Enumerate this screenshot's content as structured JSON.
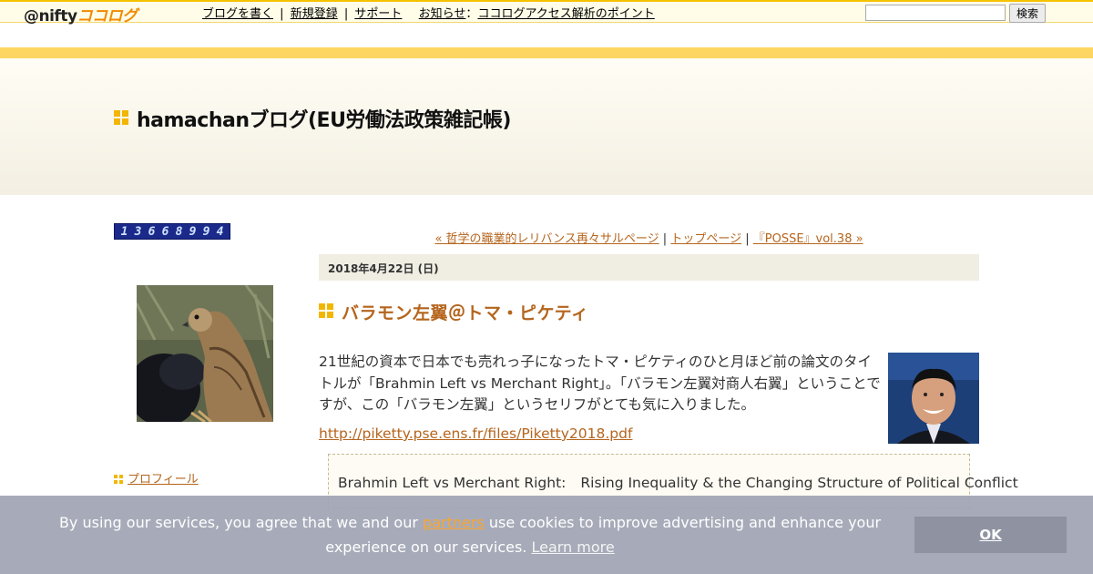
{
  "topbar": {
    "logo_at": "@nifty",
    "logo_kokolog": "ココログ",
    "nav": [
      {
        "label": "ブログを書く"
      },
      {
        "label": "新規登録"
      },
      {
        "label": "サポート"
      },
      {
        "label": "お知らせ"
      },
      {
        "label": "ココログアクセス解析のポイント"
      }
    ],
    "nav_sep": "|",
    "notice_colon": "：",
    "search_value": "",
    "search_button": "検索"
  },
  "header": {
    "title": "hamachanブログ(EU労働法政策雑記帳)"
  },
  "sidebar": {
    "counter_digits": [
      "1",
      "3",
      "6",
      "6",
      "8",
      "9",
      "9",
      "4"
    ],
    "profile_link": "プロフィール"
  },
  "post_nav": {
    "prev": "« 哲学の職業的レリバンス再々サルページ",
    "top": "トップページ",
    "next": "『POSSE』vol.38 »",
    "sep": "|"
  },
  "post": {
    "date": "2018年4月22日 (日)",
    "title": "バラモン左翼＠トマ・ピケティ",
    "body": "21世紀の資本で日本でも売れっ子になったトマ・ピケティのひと月ほど前の論文のタイトルが「Brahmin Left vs Merchant Right」。「バラモン左翼対商人右翼」ということですが、この「バラモン左翼」というセリフがとても気に入りました。",
    "link": "http://piketty.pse.ens.fr/files/Piketty2018.pdf",
    "quote_part1": "Brahmin Left vs Merchant Right:",
    "quote_part2": "Rising Inequality & the Changing Structure of Political Conflict"
  },
  "cookie": {
    "text_before": "By using our services, you agree that we and our ",
    "partners": "partners",
    "text_after": " use cookies to improve advertising and enhance your experience on our services. ",
    "learn_more": "Learn more",
    "ok": "OK"
  },
  "colors": {
    "accent_yellow": "#f2b600",
    "link_brown": "#b5651d",
    "stripe": "#fcd661"
  }
}
